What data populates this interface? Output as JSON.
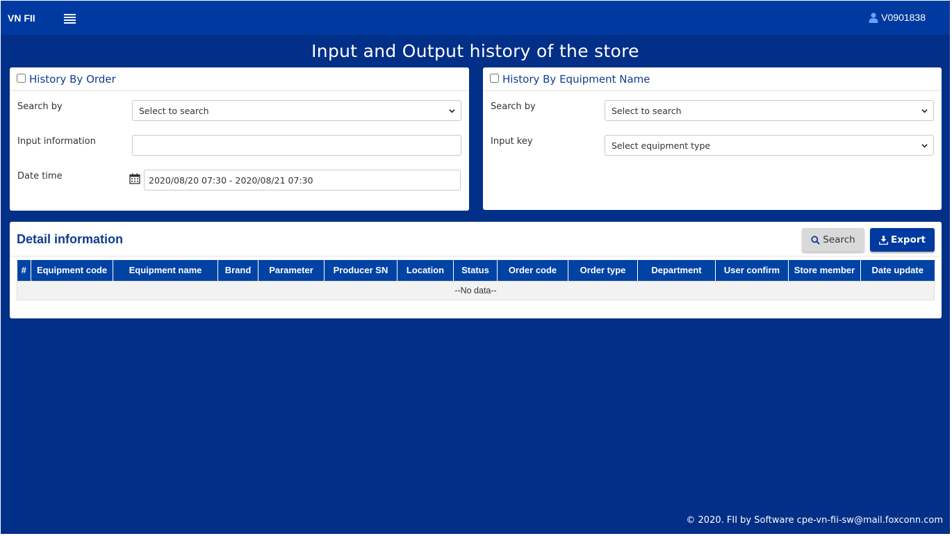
{
  "navbar": {
    "brand": "VN FII",
    "username": "V0901838"
  },
  "page_title": "Input and Output history of the store",
  "order_panel": {
    "title": "History By Order",
    "checked": false,
    "search_by_label": "Search by",
    "search_by_value": "Select to search",
    "input_info_label": "Input information",
    "input_info_value": "",
    "date_time_label": "Date time",
    "date_time_value": "2020/08/20 07:30 - 2020/08/21 07:30"
  },
  "equipment_panel": {
    "title": "History By Equipment Name",
    "checked": false,
    "search_by_label": "Search by",
    "search_by_value": "Select to search",
    "input_key_label": "Input key",
    "input_key_value": "Select equipment type"
  },
  "detail": {
    "title": "Detail information",
    "search_label": "Search",
    "export_label": "Export",
    "columns": [
      "#",
      "Equipment code",
      "Equipment name",
      "Brand",
      "Parameter",
      "Producer SN",
      "Location",
      "Status",
      "Order code",
      "Order type",
      "Department",
      "User confirm",
      "Store member",
      "Date update"
    ],
    "empty_text": "--No data--"
  },
  "footer": {
    "text": "© 2020. FII by Software cpe-vn-fii-sw@mail.foxconn.com"
  },
  "colors": {
    "background": "#022f87",
    "navbar": "#003aa0",
    "table_header": "#0043a4",
    "panel_title": "#0f3c91"
  }
}
